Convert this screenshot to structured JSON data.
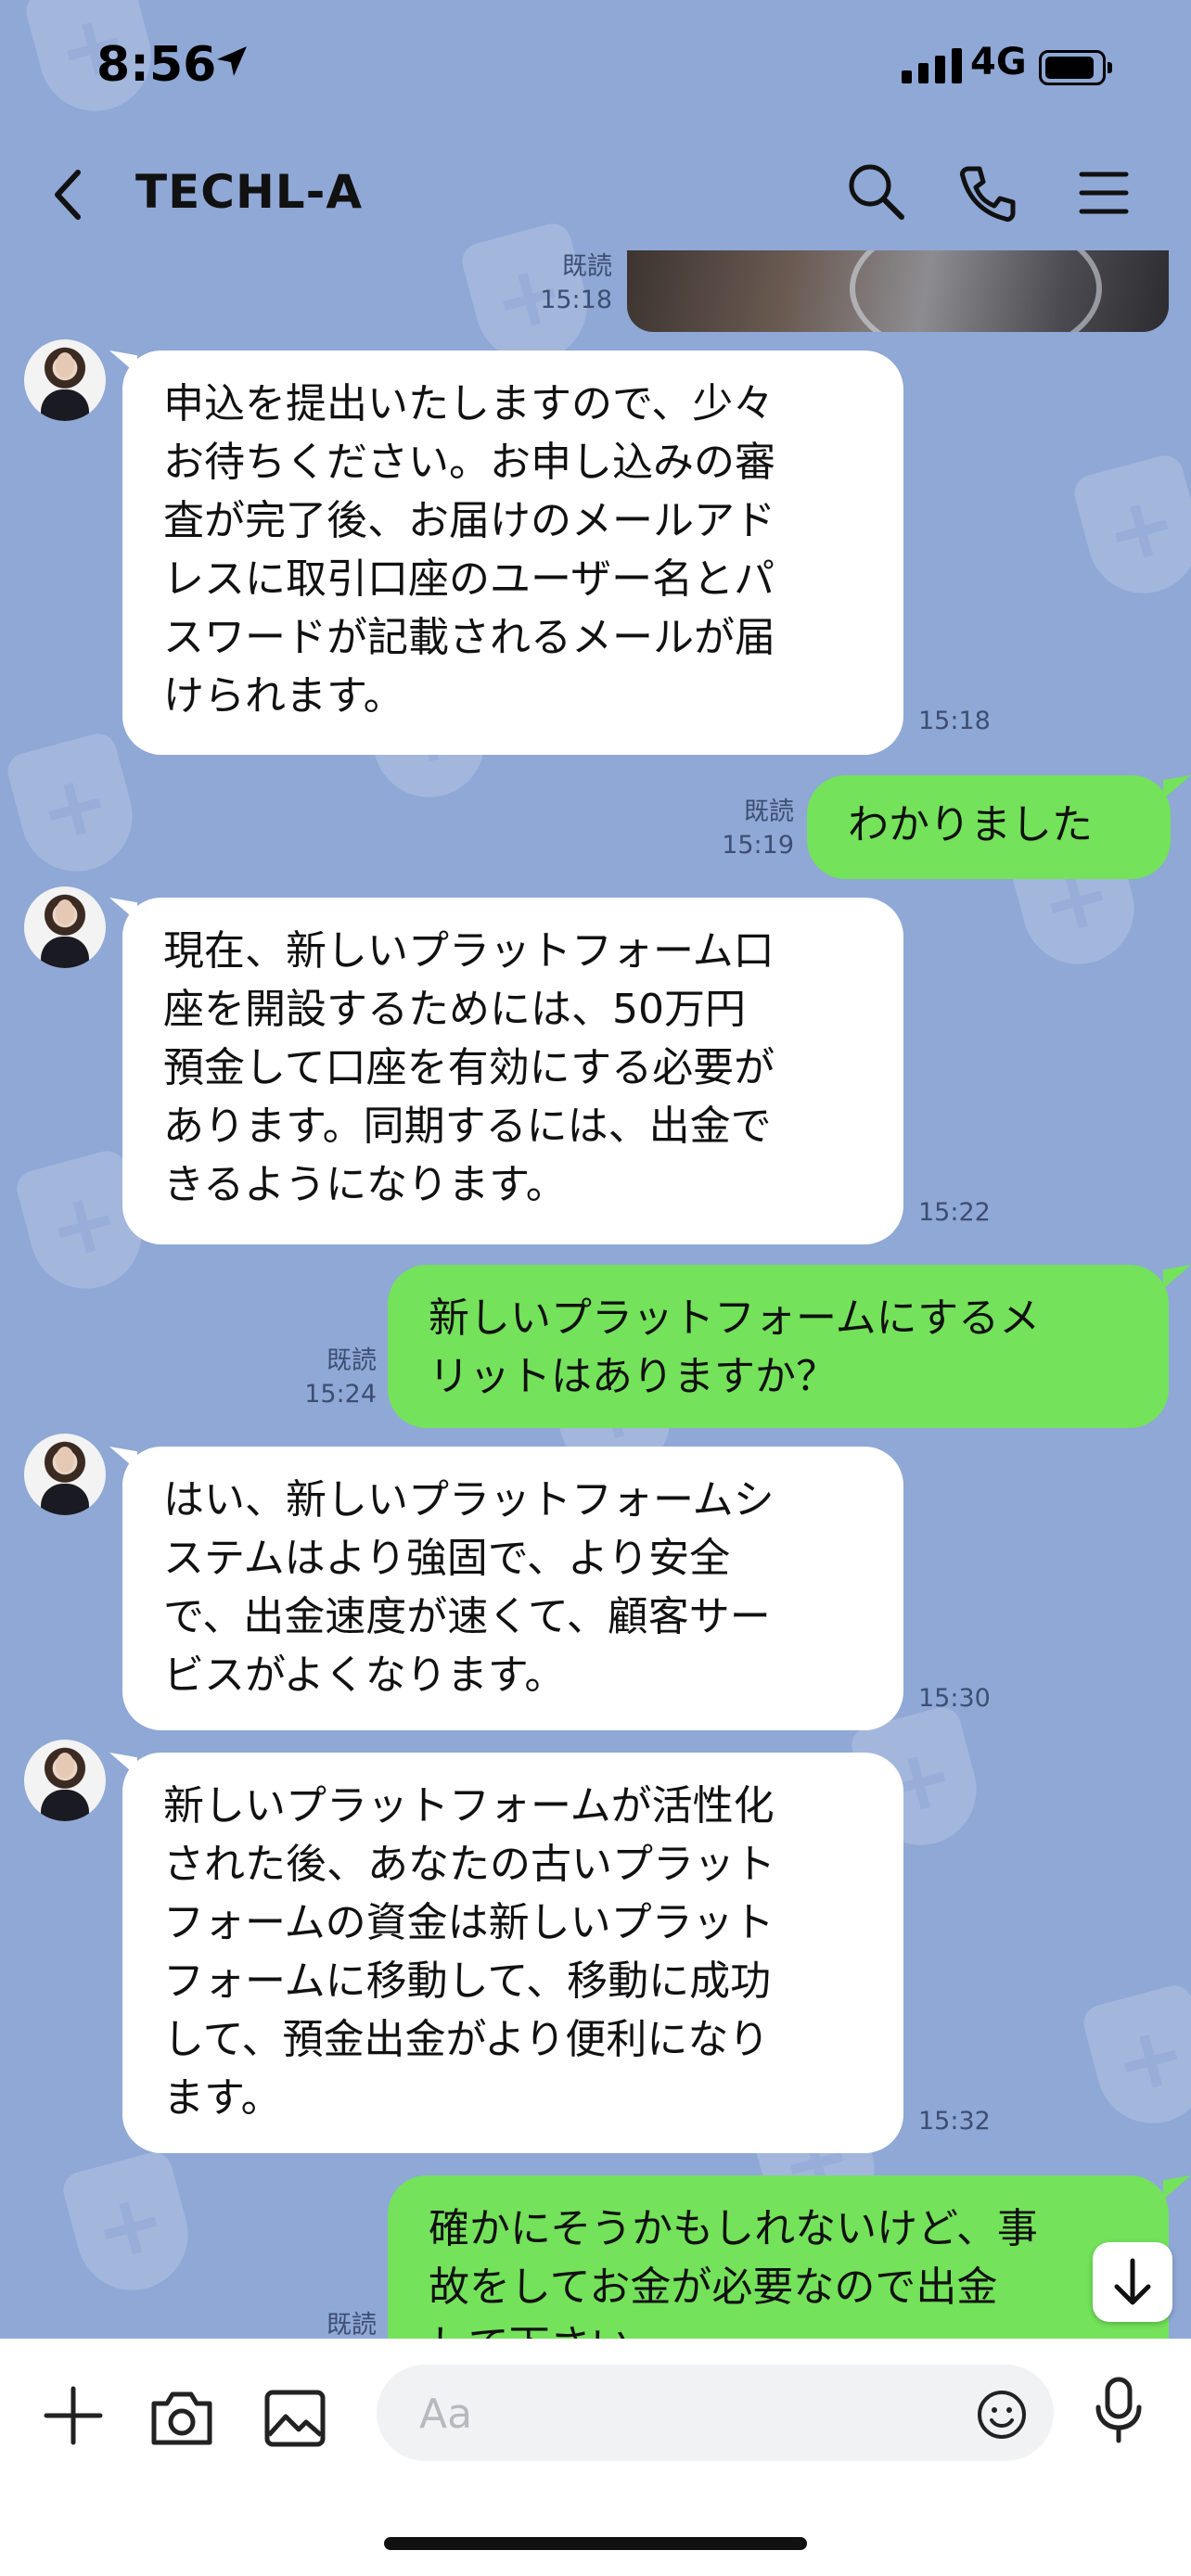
{
  "status_bar": {
    "time": "8:56",
    "network": "4G"
  },
  "header": {
    "title": "TECHL-A"
  },
  "messages": [
    {
      "read": "既読",
      "time": "15:18"
    },
    {
      "text": "申込を提出いたしますので、少々\nお待ちください。お申し込みの審\n査が完了後、お届けのメールアド\nレスに取引口座のユーザー名とパ\nスワードが記載されるメールが届\nけられます。",
      "time": "15:18"
    },
    {
      "text": "わかりました",
      "read": "既読",
      "time": "15:19"
    },
    {
      "text": "現在、新しいプラットフォーム口\n座を開設するためには、50万円\n預金して口座を有効にする必要が\nあります。同期するには、出金で\nきるようになります。",
      "time": "15:22"
    },
    {
      "text": "新しいプラットフォームにするメ\nリットはありますか？",
      "read": "既読",
      "time": "15:24"
    },
    {
      "text": "はい、新しいプラットフォームシ\nステムはより強固で、より安全\nで、出金速度が速くて、顧客サー\nビスがよくなります。",
      "time": "15:30"
    },
    {
      "text": "新しいプラットフォームが活性化\nされた後、あなたの古いプラット\nフォームの資金は新しいプラット\nフォームに移動して、移動に成功\nして、預金出金がより便利になり\nます。",
      "time": "15:32"
    },
    {
      "text": "確かにそうかもしれないけど、事\n故をしてお金が必要なので出金\nして下さい",
      "read": "既読"
    }
  ],
  "composer": {
    "placeholder": "Aa"
  },
  "colors": {
    "background": "#8fa8d6",
    "outgoing_bubble": "#74e25a",
    "incoming_bubble": "#ffffff"
  }
}
